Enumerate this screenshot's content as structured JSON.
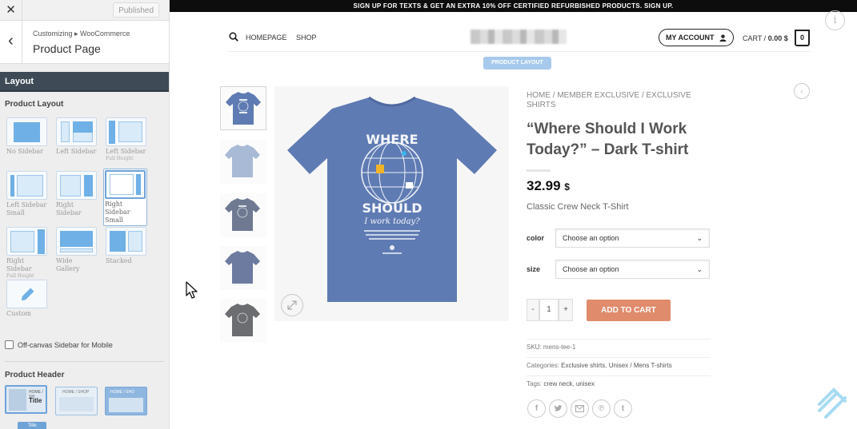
{
  "customizer": {
    "close_icon": "close-icon",
    "published_label": "Published",
    "breadcrumb": "Customizing ▸ WooCommerce",
    "title": "Product Page",
    "section_title": "Layout",
    "product_layout_label": "Product Layout",
    "layouts": [
      {
        "label": "No Sidebar",
        "sub": ""
      },
      {
        "label": "Left Sidebar",
        "sub": ""
      },
      {
        "label": "Left Sidebar",
        "sub": "Full Height"
      },
      {
        "label": "Left Sidebar Small",
        "sub": ""
      },
      {
        "label": "Right Sidebar",
        "sub": ""
      },
      {
        "label": "Right Sidebar Small",
        "sub": ""
      },
      {
        "label": "Right Sidebar",
        "sub": "Full Height"
      },
      {
        "label": "Wide Gallery",
        "sub": ""
      },
      {
        "label": "Stacked",
        "sub": ""
      },
      {
        "label": "Custom",
        "sub": ""
      }
    ],
    "selected_layout": "Right Sidebar Small",
    "offcanvas_label": "Off-canvas Sidebar for Mobile",
    "product_header_label": "Product Header",
    "header_options": [
      {
        "mini": "HOME / SH",
        "title": "Title"
      },
      {
        "mini": "HOME / SHOP",
        "title": ""
      },
      {
        "mini": "HOME / SHO",
        "title": ""
      }
    ],
    "next_header_title": "Title",
    "accent_color": "#6ea3d8",
    "section_color": "#3e4b56"
  },
  "store": {
    "promo_bar": "SIGN UP FOR TEXTS & GET AN EXTRA 10% OFF CERTIFIED REFURBISHED PRODUCTS. SIGN UP.",
    "nav": [
      {
        "label": "HOMEPAGE"
      },
      {
        "label": "SHOP"
      }
    ],
    "search_icon": "search-icon",
    "account_label": "MY ACCOUNT",
    "cart_label": "CART /",
    "cart_total": "0.00 $",
    "cart_count": "0",
    "product_layout_badge": "PRODUCT LAYOUT",
    "breadcrumb": [
      "HOME",
      "MEMBER EXCLUSIVE",
      "EXCLUSIVE SHIRTS"
    ],
    "breadcrumb_sep": "/",
    "product_title": "“Where Should I Work Today?” – Dark T-shirt",
    "price": "32.99",
    "currency": "$",
    "short_description": "Classic Crew Neck T-Shirt",
    "variations": [
      {
        "label": "color",
        "placeholder": "Choose an option"
      },
      {
        "label": "size",
        "placeholder": "Choose an option"
      }
    ],
    "quantity": "1",
    "qty_minus": "-",
    "qty_plus": "+",
    "add_to_cart": "ADD TO CART",
    "sku_label": "SKU:",
    "sku": "mens-tee-1",
    "categories_label": "Categories:",
    "categories": [
      "Exclusive shirts",
      "Unisex / Mens T-shirts"
    ],
    "tags_label": "Tags:",
    "tags": [
      "crew neck",
      "unisex"
    ],
    "share_icons": [
      "facebook-icon",
      "twitter-icon",
      "email-icon",
      "pinterest-icon",
      "tumblr-icon"
    ],
    "shirt_text": {
      "line1": "WHERE",
      "line2": "SHOULD",
      "line3": "I work today?"
    },
    "shirt_color": "#5f7bb3",
    "button_color": "#e08b6c"
  }
}
